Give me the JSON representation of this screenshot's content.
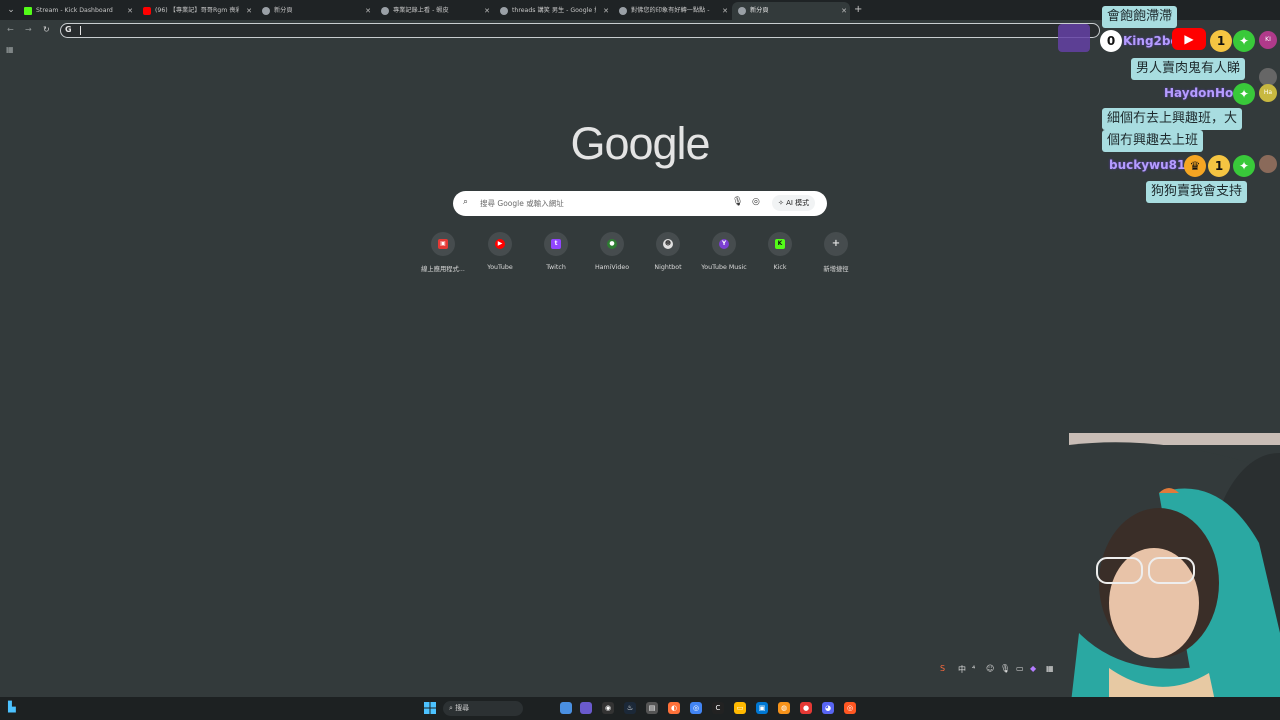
{
  "browser": {
    "tabs": [
      {
        "title": "Stream - Kick Dashboard",
        "favicon_color": "#53fc18",
        "active": false
      },
      {
        "title": "(96) 【專業記】哥哥Rgm 喪彩",
        "favicon_color": "#ff0000",
        "active": false
      },
      {
        "title": "新分頁",
        "favicon_color": "#9aa0a6",
        "active": false
      },
      {
        "title": "專業記錄上看 - 蝦皮",
        "favicon_color": "#9aa0a6",
        "active": false
      },
      {
        "title": "threads 講笑 男生 - Google 搜",
        "favicon_color": "#9aa0a6",
        "active": false
      },
      {
        "title": "對佛您的印象有好轉一點點 -",
        "favicon_color": "#9aa0a6",
        "active": false
      },
      {
        "title": "新分頁",
        "favicon_color": "#9aa0a6",
        "active": true
      }
    ],
    "omnibox_value": "",
    "nav": {
      "back": "←",
      "forward": "→",
      "reload": "↻"
    }
  },
  "newtab": {
    "logo": "Google",
    "search_placeholder": "搜尋 Google 或輸入網址",
    "ai_mode_label": "AI 模式",
    "shortcuts": [
      {
        "label": "線上應用程式...",
        "icon_color": "#e53935",
        "glyph": "▣"
      },
      {
        "label": "YouTube",
        "icon_color": "#ff0000",
        "glyph": "▶"
      },
      {
        "label": "Twitch",
        "icon_color": "#9146ff",
        "glyph": "t"
      },
      {
        "label": "HamiVideo",
        "icon_color": "#2e7d32",
        "glyph": "●"
      },
      {
        "label": "Nightbot",
        "icon_color": "#e0e0e0",
        "glyph": "☻"
      },
      {
        "label": "YouTube Music",
        "icon_color": "#7b3fd1",
        "glyph": "Y"
      },
      {
        "label": "Kick",
        "icon_color": "#53fc18",
        "glyph": "K"
      },
      {
        "label": "新增捷徑",
        "icon_color": "#464c4e",
        "glyph": "+"
      }
    ]
  },
  "chat": {
    "messages": [
      {
        "text": "會飽飽滯滯"
      },
      {
        "user": "King2bo"
      },
      {
        "text": "男人賣肉鬼有人睇"
      },
      {
        "user": "HaydonHon"
      },
      {
        "text": "細個冇去上興趣班，大"
      },
      {
        "text": "個冇興趣去上班"
      },
      {
        "user": "buckywu815"
      },
      {
        "text": "狗狗賣我會支持"
      }
    ],
    "avatars": [
      "KI",
      "Ha"
    ],
    "badges": [
      "0",
      "1"
    ]
  },
  "taskbar": {
    "search_label": "搜尋",
    "icon_colors": [
      "#4a90e2",
      "#6a5acd",
      "#1db954",
      "#ff7139",
      "#4285f4",
      "#ffb900",
      "#0078d4",
      "#f7931a",
      "#e53935",
      "#5865f2",
      "#ff5722"
    ],
    "tray_ime": "中"
  }
}
